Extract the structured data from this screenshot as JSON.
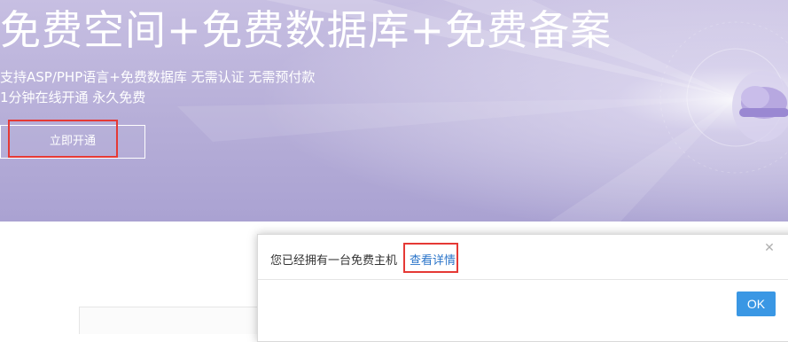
{
  "hero": {
    "title": "免费空间+免费数据库+免费备案",
    "subtitle_line1": "支持ASP/PHP语言+免费数据库 无需认证 无需预付款",
    "subtitle_line2": "1分钟在线开通 永久免费",
    "open_button_label": "立即开通"
  },
  "dialog": {
    "message": "您已经拥有一台免费主机",
    "link_label": "查看详情",
    "close_icon": "close-icon",
    "ok_label": "OK"
  },
  "colors": {
    "highlight": "#e53935",
    "link": "#2a74c9",
    "ok_button": "#3a97e4",
    "hero_bg": "#b6aed8"
  }
}
